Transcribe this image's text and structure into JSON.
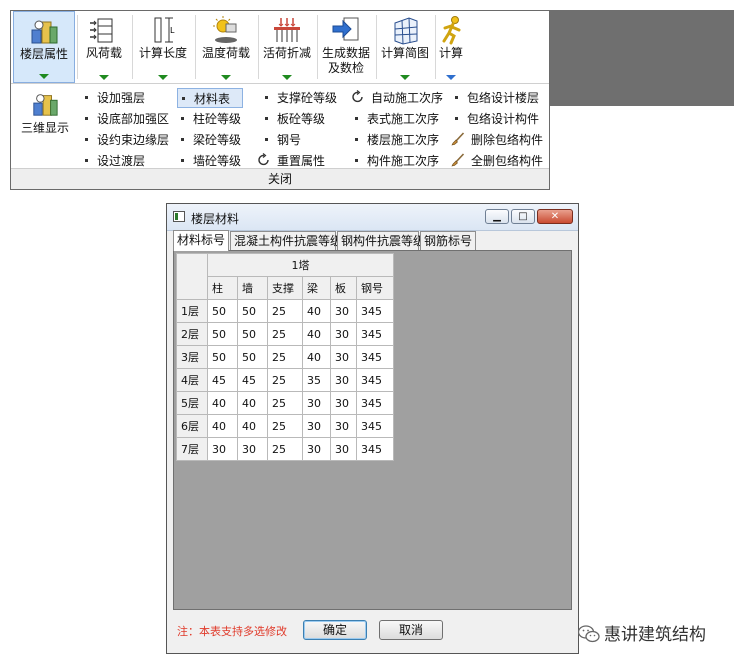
{
  "ribbon": {
    "buttons": [
      {
        "label": "楼层属性",
        "arrow": true
      },
      {
        "label": "风荷载",
        "arrow": true
      },
      {
        "label": "计算长度",
        "arrow": true
      },
      {
        "label": "温度荷载",
        "arrow": true
      },
      {
        "label": "活荷折减",
        "arrow": true
      },
      {
        "label": "生成数据",
        "label2": "及数检",
        "arrow": false
      },
      {
        "label": "计算简图",
        "arrow": true
      },
      {
        "label": "计算",
        "arrow": true
      }
    ],
    "panel": {
      "view3d_label": "三维显示",
      "col1": [
        "设加强层",
        "设底部加强区",
        "设约束边缘层",
        "设过渡层"
      ],
      "col2": [
        "材料表",
        "柱砼等级",
        "梁砼等级",
        "墙砼等级"
      ],
      "col3": [
        "支撑砼等级",
        "板砼等级",
        "钢号",
        "重置属性"
      ],
      "col4": [
        "自动施工次序",
        "表式施工次序",
        "楼层施工次序",
        "构件施工次序"
      ],
      "col5": [
        "包络设计楼层",
        "包络设计构件",
        "删除包络构件",
        "全删包络构件"
      ]
    },
    "footer_label": "关闭"
  },
  "dialog": {
    "title": "楼层材料",
    "tabs": [
      "材料标号",
      "混凝土构件抗震等级",
      "钢构件抗震等级",
      "钢筋标号"
    ],
    "active_tab": 0,
    "table": {
      "group_header": "1塔",
      "columns": [
        "柱",
        "墙",
        "支撑",
        "梁",
        "板",
        "钢号"
      ],
      "rows": [
        {
          "floor": "1层",
          "values": [
            "50",
            "50",
            "25",
            "40",
            "30",
            "345"
          ]
        },
        {
          "floor": "2层",
          "values": [
            "50",
            "50",
            "25",
            "40",
            "30",
            "345"
          ]
        },
        {
          "floor": "3层",
          "values": [
            "50",
            "50",
            "25",
            "40",
            "30",
            "345"
          ]
        },
        {
          "floor": "4层",
          "values": [
            "45",
            "45",
            "25",
            "35",
            "30",
            "345"
          ]
        },
        {
          "floor": "5层",
          "values": [
            "40",
            "40",
            "25",
            "30",
            "30",
            "345"
          ]
        },
        {
          "floor": "6层",
          "values": [
            "40",
            "40",
            "25",
            "30",
            "30",
            "345"
          ]
        },
        {
          "floor": "7层",
          "values": [
            "30",
            "30",
            "25",
            "30",
            "30",
            "345"
          ]
        }
      ]
    },
    "note": "注：本表支持多选修改",
    "ok_label": "确定",
    "cancel_label": "取消"
  },
  "watermark": "惠讲建筑结构",
  "colors": {
    "note": "#e03a2a",
    "arrow_green": "#1f8a1f",
    "arrow_blue": "#2f6fce",
    "active_bg": "#d6e8fa"
  }
}
